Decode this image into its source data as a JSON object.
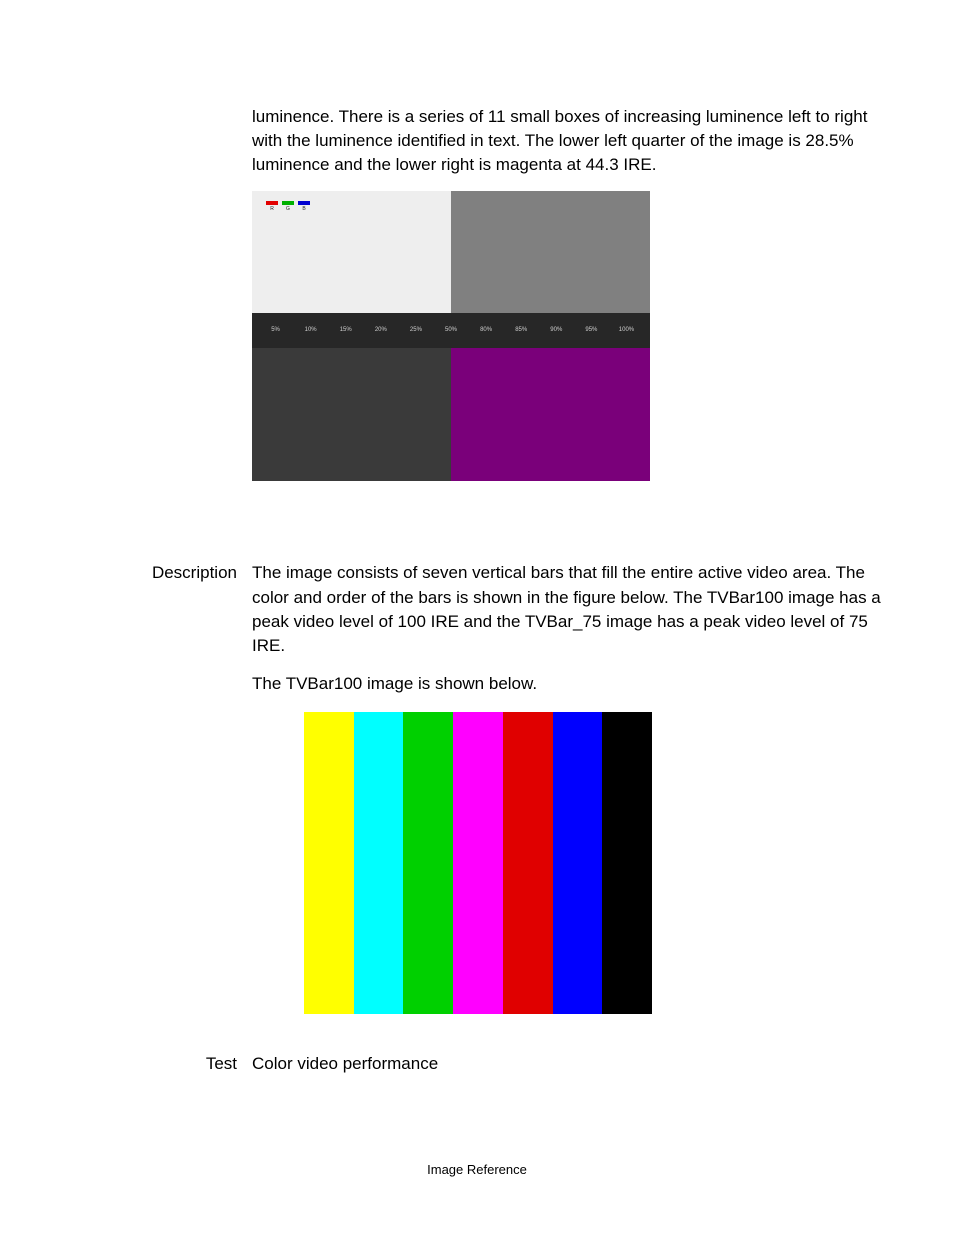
{
  "intro_paragraph": "luminence. There is a series of 11 small boxes of increasing luminence left to right with the luminence identified in text. The lower left quarter of the image is 28.5% luminence and the lower right is magenta at 44.3 IRE.",
  "rgb_boxes": [
    {
      "label": "R",
      "color": "#e20000"
    },
    {
      "label": "G",
      "color": "#00b000"
    },
    {
      "label": "B",
      "color": "#0000d0"
    }
  ],
  "luminence_steps": [
    "5%",
    "10%",
    "15%",
    "20%",
    "25%",
    "50%",
    "80%",
    "85%",
    "90%",
    "95%",
    "100%"
  ],
  "section2": {
    "label": "Description",
    "para1": "The image consists of seven vertical bars that fill the entire active video area. The color and order of the bars is shown in the figure below. The TVBar100 image has a peak video level of 100 IRE and the TVBar_75 image has a peak video level of 75 IRE.",
    "para2": "The TVBar100 image is shown below."
  },
  "color_bars": [
    "#ffff00",
    "#00ffff",
    "#00d000",
    "#ff00ff",
    "#e00000",
    "#0000ff",
    "#000000"
  ],
  "section3": {
    "label": "Test",
    "text": "Color video performance"
  },
  "footer": "Image Reference"
}
